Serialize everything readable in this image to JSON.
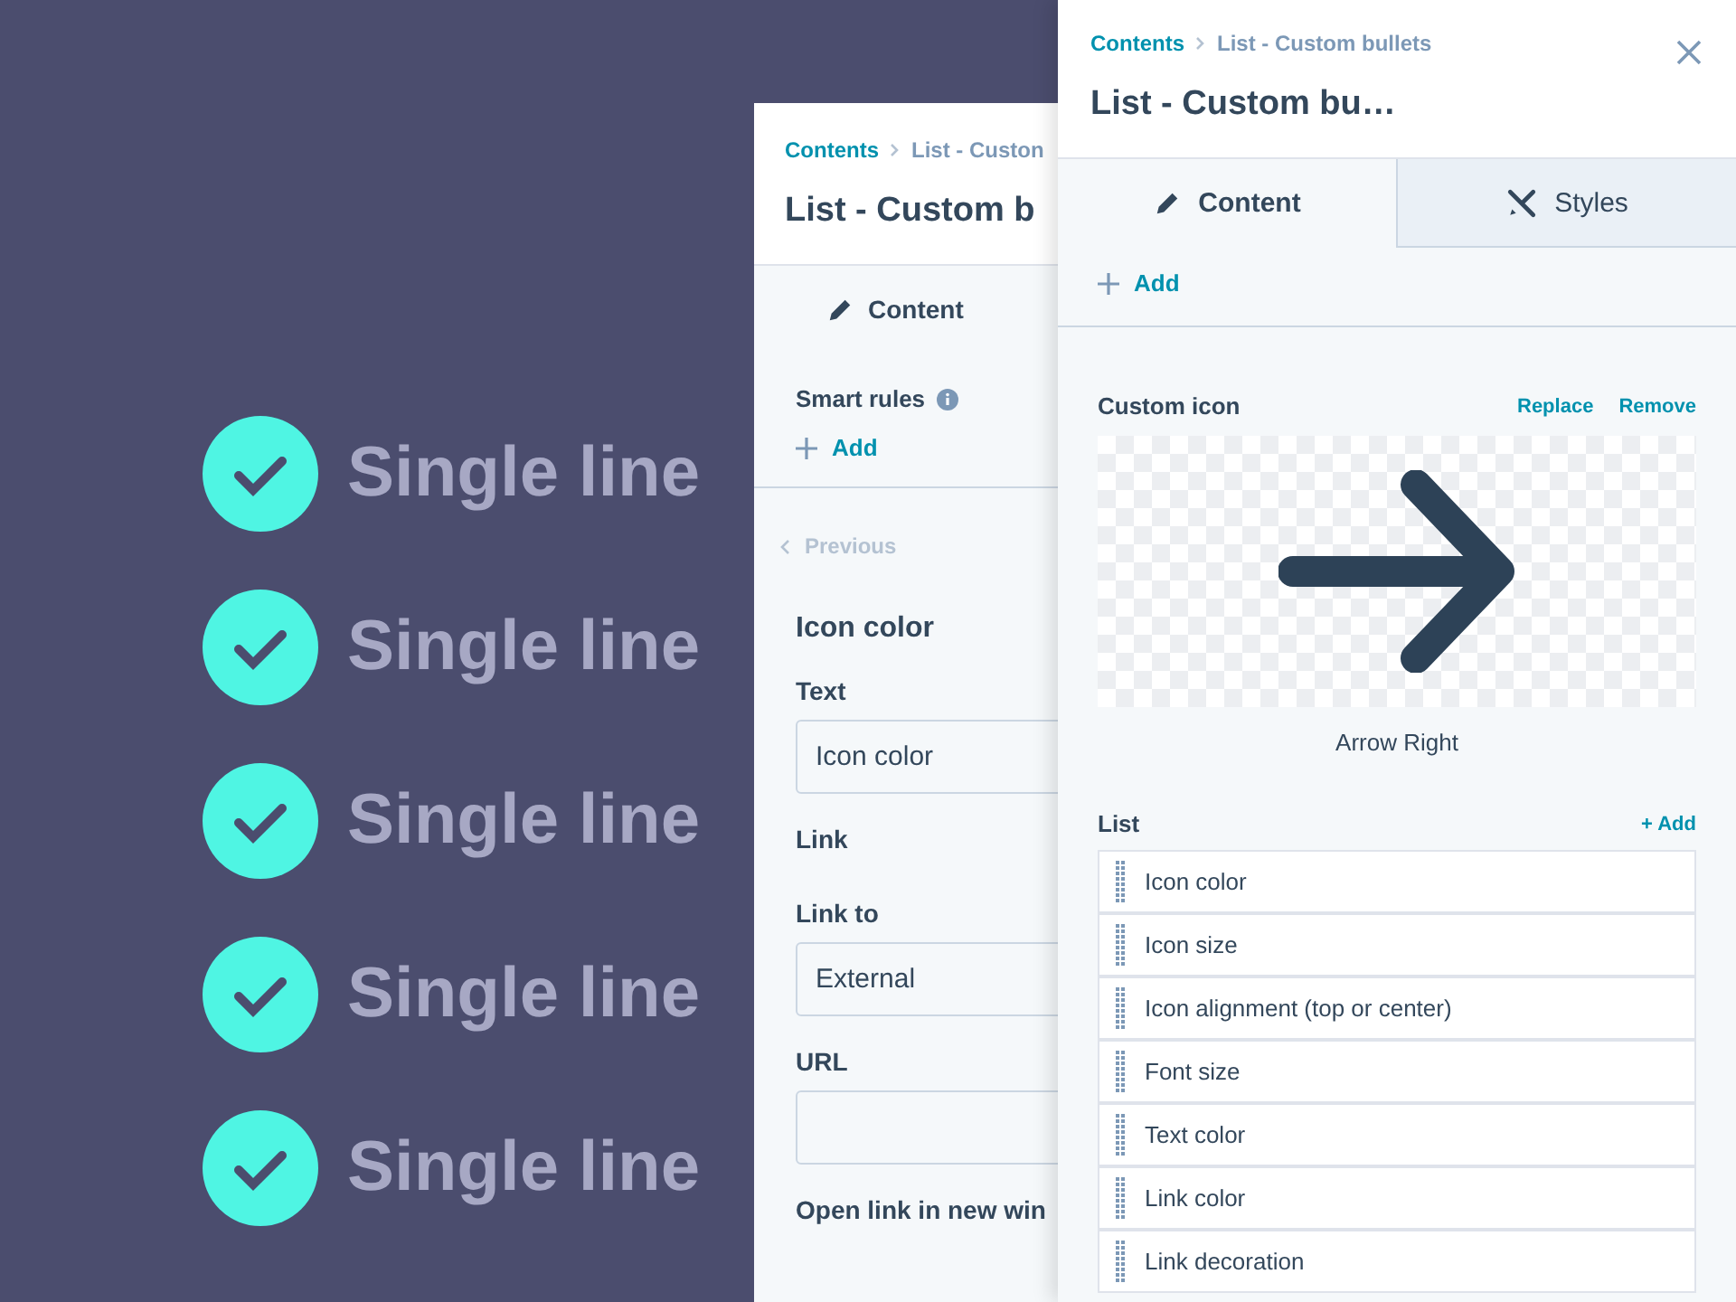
{
  "preview": {
    "items": [
      {
        "text": "Single line"
      },
      {
        "text": "Single line"
      },
      {
        "text": "Single line"
      },
      {
        "text": "Single line"
      },
      {
        "text": "Single line"
      }
    ]
  },
  "back_panel": {
    "breadcrumb": [
      "Contents",
      "List - Custon"
    ],
    "title": "List - Custom b",
    "tabs": [
      {
        "label": "Content",
        "selected": true
      }
    ],
    "smart_rules": {
      "label": "Smart rules",
      "add": "Add"
    },
    "previous": {
      "label": "Previous",
      "disabled": true
    },
    "heading": "Icon color",
    "fields": [
      {
        "kind": "label",
        "label": "Text"
      },
      {
        "kind": "input",
        "value": "Icon color"
      },
      {
        "kind": "label",
        "label": "Link"
      },
      {
        "kind": "label",
        "label": "Link to"
      },
      {
        "kind": "input",
        "value": "External"
      },
      {
        "kind": "label",
        "label": "URL"
      },
      {
        "kind": "input"
      },
      {
        "kind": "label",
        "label": "Open link in new win"
      }
    ]
  },
  "front_panel": {
    "breadcrumb": [
      "Contents",
      "List - Custom bullets"
    ],
    "title": "List - Custom bu…",
    "tabs": [
      {
        "label": "Content",
        "selected": true
      },
      {
        "label": "Styles",
        "selected": false
      }
    ],
    "add": "Add",
    "custom_icon": {
      "label": "Custom icon",
      "actions": [
        "Replace",
        "Remove"
      ],
      "caption": "Arrow Right"
    },
    "list": {
      "label": "List",
      "add": "+ Add",
      "items": [
        "Icon color",
        "Icon size",
        "Icon alignment (top or center)",
        "Font size",
        "Text color",
        "Link color",
        "Link decoration"
      ]
    }
  }
}
